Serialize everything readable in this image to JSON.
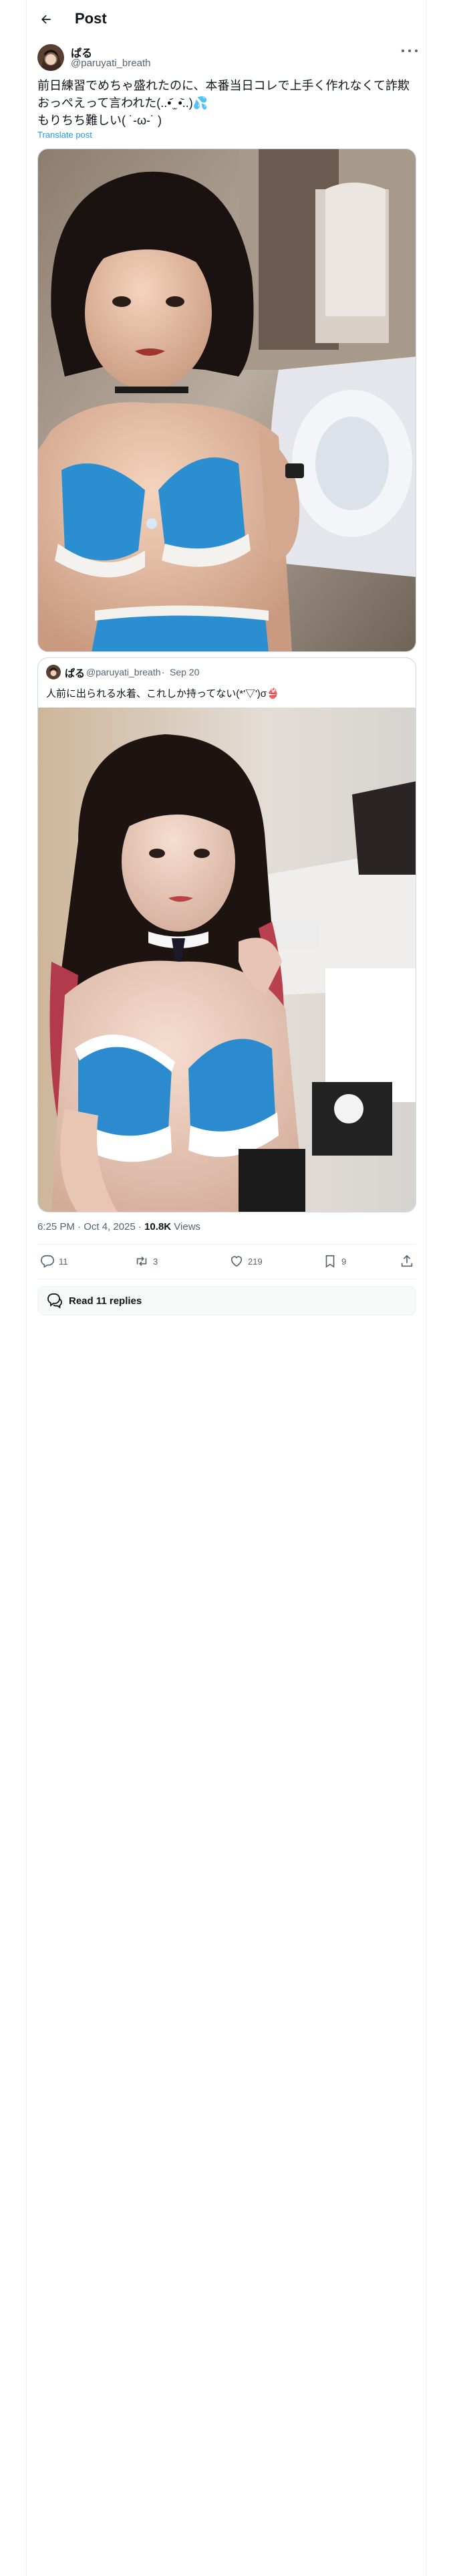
{
  "header": {
    "title": "Post"
  },
  "post": {
    "author_name": "ぱる",
    "author_handle": "@paruyati_breath",
    "text": "前日練習でめちゃ盛れたのに、本番当日コレで上手く作れなくて詐欺おっぺえって言われた(..•᷄ ̫ •᷅..)💦\nもりちち難しい( ˙-ω-˙ )",
    "translate_label": "Translate post",
    "time": "6:25 PM · Oct 4, 2025",
    "separator": "·",
    "views_count": "10.8K",
    "views_label": "Views"
  },
  "quote": {
    "author_name": "ぱる",
    "author_handle": "@paruyati_breath",
    "separator": "·",
    "date": "Sep 20",
    "text": "人前に出られる水着、これしか持ってない(*'▽')σ👙"
  },
  "actions": {
    "replies": "11",
    "reposts": "3",
    "likes": "219",
    "bookmarks": "9"
  },
  "read_replies": "Read 11 replies",
  "colors": {
    "accent": "#1d9bf0",
    "text": "#0f1419",
    "muted": "#536471",
    "border": "#cfd9de"
  },
  "icons": [
    "back-arrow-icon",
    "more-icon",
    "reply-icon",
    "repost-icon",
    "like-icon",
    "bookmark-icon",
    "share-icon",
    "speech-bubbles-icon"
  ]
}
